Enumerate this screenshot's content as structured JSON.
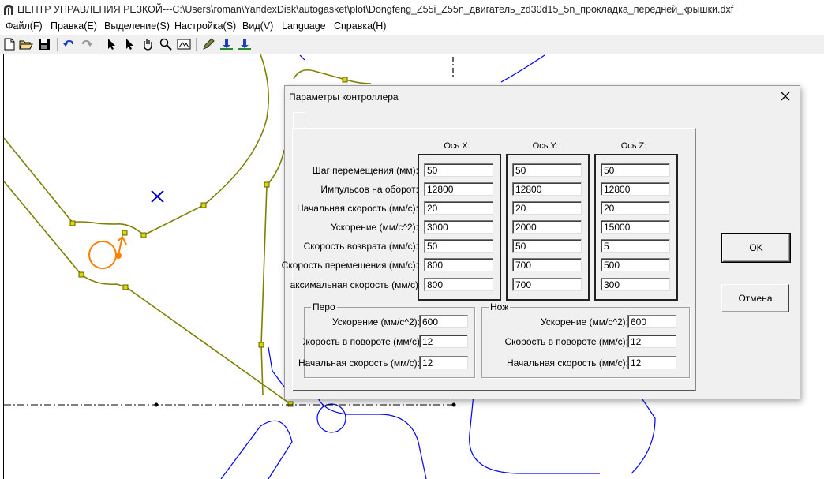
{
  "window": {
    "title": "ЦЕНТР УПРАВЛЕНИЯ РЕЗКОЙ---C:\\Users\\roman\\YandexDisk\\autogasket\\plot\\Dongfeng_Z55i_Z55n_двигатель_zd30d15_5n_прокладка_передней_крышки.dxf"
  },
  "menu": {
    "items": [
      "Файл(F)",
      "Правка(E)",
      "Выделение(S)",
      "Настройка(S)",
      "Вид(V)",
      "Language",
      "Справка(H)"
    ]
  },
  "toolbar": {
    "buttons": [
      "new-file-icon",
      "open-folder-icon",
      "save-icon",
      "undo-icon",
      "redo-icon",
      "select-arrow-icon",
      "select-node-icon",
      "pan-hand-icon",
      "zoom-icon",
      "zoom-fit-icon",
      "pen-icon",
      "pen-down-icon",
      "knife-down-icon"
    ]
  },
  "dialog": {
    "title": "Параметры контроллера",
    "axes": {
      "headers": [
        "Ось X:",
        "Ось Y:",
        "Ось Z:"
      ],
      "row_labels": [
        "Шаг перемещения (мм):",
        "Импульсов на оборот:",
        "Начальная скорость (мм/с):",
        "Ускорение (мм/с^2):",
        "Скорость возврата (мм/с):",
        "Скорость перемещения (мм/с):",
        "Максимальная скорость (мм/с):"
      ],
      "x": [
        "50",
        "12800",
        "20",
        "3000",
        "50",
        "800",
        "800"
      ],
      "y": [
        "50",
        "12800",
        "20",
        "2000",
        "50",
        "700",
        "700"
      ],
      "z": [
        "50",
        "12800",
        "20",
        "15000",
        "5",
        "500",
        "300"
      ]
    },
    "pen": {
      "title": "Перо",
      "labels": [
        "Ускорение (мм/с^2):",
        "Скорость в повороте (мм/с):",
        "Начальная скорость (мм/с):"
      ],
      "values": [
        "600",
        "12",
        "12"
      ]
    },
    "knife": {
      "title": "Нож",
      "labels": [
        "Ускорение (мм/с^2):",
        "Скорость в повороте (мм/с):",
        "Начальная скорость (мм/с):"
      ],
      "values": [
        "600",
        "12",
        "12"
      ]
    },
    "ok_label": "OK",
    "cancel_label": "Отмена"
  },
  "colors": {
    "drawing_line": "#808000",
    "blue_line": "#0000ff",
    "cursor_orange": "#ff7f00",
    "default_button_outline": "#000000"
  }
}
